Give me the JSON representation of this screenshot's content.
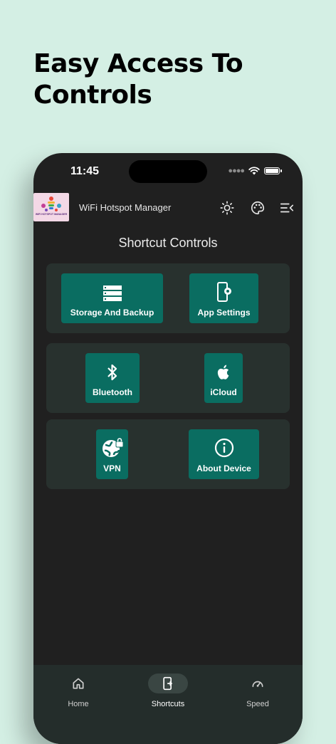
{
  "headline": {
    "line1": "Easy Access To",
    "line2": "Controls"
  },
  "status_bar": {
    "time": "11:45"
  },
  "app_bar": {
    "logo_text": "WIFI HOTSPOT MANAGER",
    "title": "WiFi Hotspot Manager",
    "actions": [
      "brightness-icon",
      "palette-icon",
      "menu-open-icon"
    ]
  },
  "page": {
    "heading": "Shortcut Controls"
  },
  "shortcuts": [
    {
      "label": "Storage And Backup",
      "icon": "storage-icon"
    },
    {
      "label": "App Settings",
      "icon": "phone-settings-icon"
    },
    {
      "label": "Bluetooth",
      "icon": "bluetooth-icon"
    },
    {
      "label": "iCloud",
      "icon": "apple-icon"
    },
    {
      "label": "VPN",
      "icon": "vpn-globe-lock-icon"
    },
    {
      "label": "About Device",
      "icon": "info-icon"
    }
  ],
  "bottom_nav": {
    "items": [
      {
        "label": "Home",
        "icon": "home-icon"
      },
      {
        "label": "Shortcuts",
        "icon": "shortcuts-icon",
        "active": true
      },
      {
        "label": "Speed",
        "icon": "speedometer-icon"
      }
    ]
  },
  "colors": {
    "page_bg": "#d4efe4",
    "phone_bg": "#202020",
    "card_bg": "#28312e",
    "tile_accent": "#0a6d61",
    "nav_bg": "#242d2b"
  }
}
